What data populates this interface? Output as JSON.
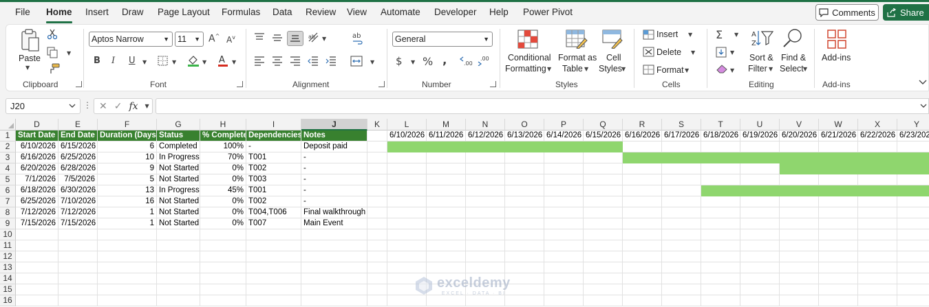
{
  "menu": {
    "items": [
      "File",
      "Home",
      "Insert",
      "Draw",
      "Page Layout",
      "Formulas",
      "Data",
      "Review",
      "View",
      "Automate",
      "Developer",
      "Help",
      "Power Pivot"
    ],
    "active": "Home",
    "comments_label": "Comments",
    "share_label": "Share"
  },
  "ribbon": {
    "clipboard": {
      "label": "Clipboard",
      "paste": "Paste"
    },
    "font": {
      "label": "Font",
      "family": "Aptos Narrow",
      "size": "11"
    },
    "alignment": {
      "label": "Alignment"
    },
    "number": {
      "label": "Number",
      "format": "General"
    },
    "styles": {
      "label": "Styles",
      "conditional_1": "Conditional",
      "conditional_2": "Formatting",
      "format_table_1": "Format as",
      "format_table_2": "Table",
      "cell_styles_1": "Cell",
      "cell_styles_2": "Styles"
    },
    "cells": {
      "label": "Cells",
      "insert": "Insert",
      "delete": "Delete",
      "format": "Format"
    },
    "editing": {
      "label": "Editing",
      "sort_1": "Sort &",
      "sort_2": "Filter",
      "find_1": "Find &",
      "find_2": "Select"
    },
    "addins": {
      "label": "Add-ins",
      "button": "Add-ins"
    }
  },
  "formula_bar": {
    "name_box": "J20",
    "formula": ""
  },
  "accent_color": "#1f7145",
  "header_fill": "#38812f",
  "bar_fill": "#8fd66e",
  "columns": [
    "D",
    "E",
    "F",
    "G",
    "H",
    "I",
    "J",
    "K",
    "L",
    "M",
    "N",
    "O",
    "P",
    "Q",
    "R",
    "S",
    "T",
    "U",
    "V",
    "W",
    "X",
    "Y"
  ],
  "selected_column": "J",
  "row_numbers": [
    "1",
    "2",
    "3",
    "4",
    "5",
    "6",
    "7",
    "8",
    "9",
    "10",
    "11",
    "12",
    "13",
    "14",
    "15",
    "16"
  ],
  "table": {
    "headers": [
      "Start Date",
      "End Date",
      "Duration (Days)",
      "Status",
      "% Complete",
      "Dependencies",
      "Notes"
    ],
    "rows": [
      [
        "6/10/2026",
        "6/15/2026",
        "6",
        "Completed",
        "100%",
        "-",
        "Deposit paid"
      ],
      [
        "6/16/2026",
        "6/25/2026",
        "10",
        "In Progress",
        "70%",
        "T001",
        "-"
      ],
      [
        "6/20/2026",
        "6/28/2026",
        "9",
        "Not Started",
        "0%",
        "T002",
        "-"
      ],
      [
        "7/1/2026",
        "7/5/2026",
        "5",
        "Not Started",
        "0%",
        "T003",
        "-"
      ],
      [
        "6/18/2026",
        "6/30/2026",
        "13",
        "In Progress",
        "45%",
        "T001",
        "-"
      ],
      [
        "6/25/2026",
        "7/10/2026",
        "16",
        "Not Started",
        "0%",
        "T002",
        "-"
      ],
      [
        "7/12/2026",
        "7/12/2026",
        "1",
        "Not Started",
        "0%",
        "T004,T006",
        "Final walkthrough"
      ],
      [
        "7/15/2026",
        "7/15/2026",
        "1",
        "Not Started",
        "0%",
        "T007",
        "Main Event"
      ]
    ]
  },
  "timeline_dates": [
    "6/10/2026",
    "6/11/2026",
    "6/12/2026",
    "6/13/2026",
    "6/14/2026",
    "6/15/2026",
    "6/16/2026",
    "6/17/2026",
    "6/18/2026",
    "6/19/2026",
    "6/20/2026",
    "6/21/2026",
    "6/22/2026",
    "6/23/2026"
  ],
  "watermark": {
    "name": "exceldemy",
    "tagline": "EXCEL · DATA · BI"
  }
}
